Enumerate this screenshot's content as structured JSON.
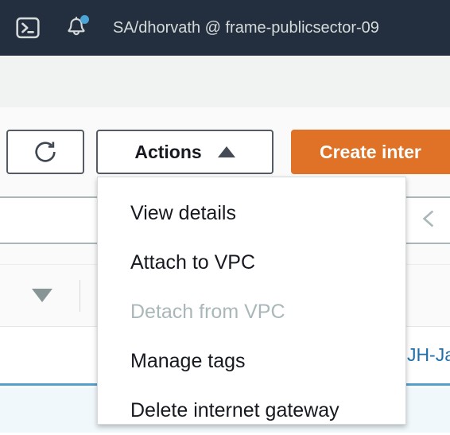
{
  "topnav": {
    "cloudshell_icon": "terminal-icon",
    "bell_icon": "notifications-bell-icon",
    "has_notification_dot": true,
    "account_label": "SA/dhorvath @ frame-publicsector-09"
  },
  "toolbar": {
    "refresh_icon": "refresh-icon",
    "actions_label": "Actions",
    "actions_caret_icon": "caret-up-icon",
    "actions_expanded": true,
    "create_label": "Create inter"
  },
  "actions_menu": {
    "items": [
      {
        "label": "View details",
        "disabled": false
      },
      {
        "label": "Attach to VPC",
        "disabled": false
      },
      {
        "label": "Detach from VPC",
        "disabled": true
      },
      {
        "label": "Manage tags",
        "disabled": false
      },
      {
        "label": "Delete internet gateway",
        "disabled": false
      }
    ]
  },
  "table": {
    "sort_icon": "sort-descending-caret-icon",
    "pager_prev_icon": "chevron-left-icon",
    "row_link_text": "JH-Ja",
    "selected_row_color": "#f1f8fc",
    "selected_row_border_color": "#539fcd"
  },
  "colors": {
    "nav_background": "#232f3e",
    "create_button": "#df7226",
    "notification_dot": "#4ba3d6",
    "link": "#1f6ea9"
  }
}
